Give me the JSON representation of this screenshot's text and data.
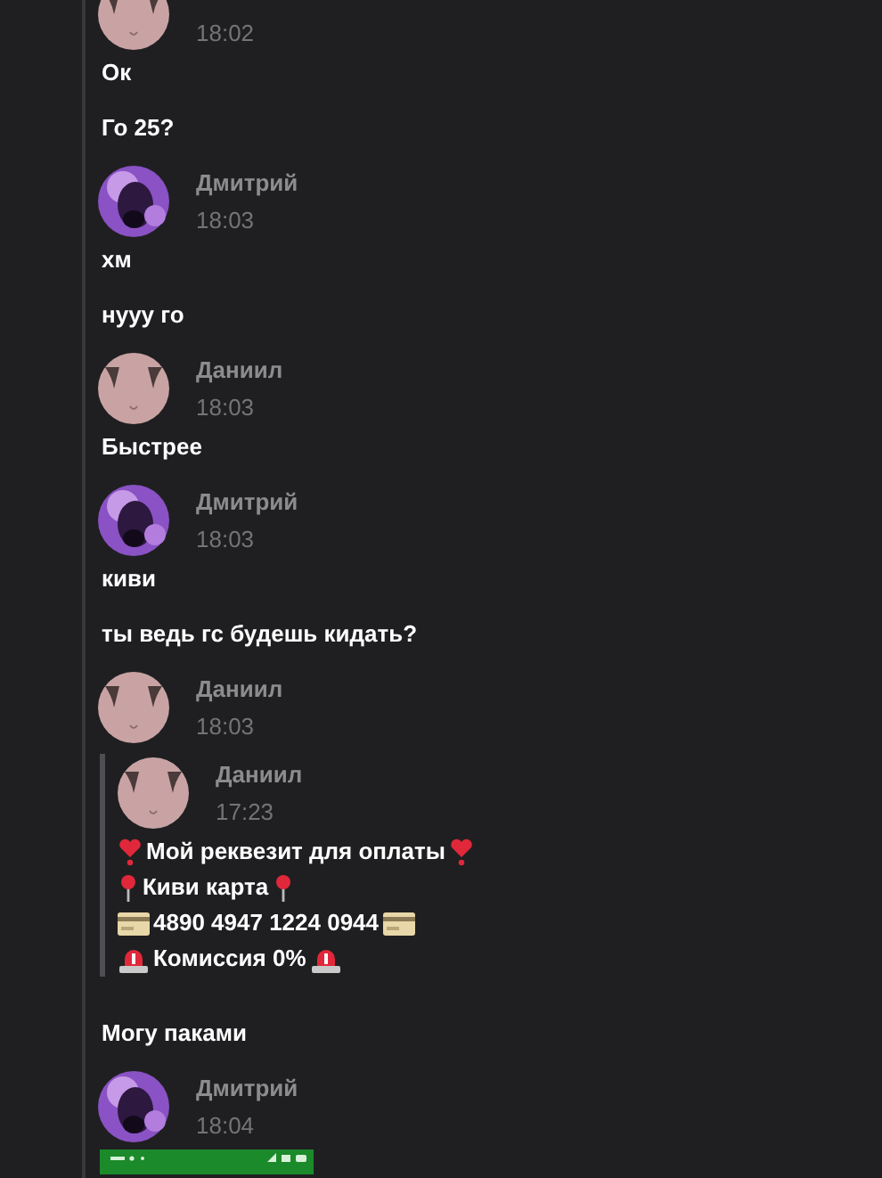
{
  "messages": [
    {
      "kind": "header",
      "avatar": {
        "kind": "pink"
      },
      "time": "18:02"
    },
    {
      "kind": "text",
      "text": "Ок"
    },
    {
      "kind": "text",
      "text": "Го 25?"
    },
    {
      "kind": "header",
      "avatar": {
        "kind": "purple"
      },
      "name": "Дмитрий",
      "time": "18:03"
    },
    {
      "kind": "text",
      "text": "хм"
    },
    {
      "kind": "text",
      "text": "нууу го"
    },
    {
      "kind": "header",
      "avatar": {
        "kind": "pink"
      },
      "name": "Даниил",
      "time": "18:03"
    },
    {
      "kind": "text",
      "text": "Быстрее"
    },
    {
      "kind": "header",
      "avatar": {
        "kind": "purple"
      },
      "name": "Дмитрий",
      "time": "18:03"
    },
    {
      "kind": "text",
      "text": "киви"
    },
    {
      "kind": "text",
      "text": "ты ведь гс будешь кидать?"
    },
    {
      "kind": "header",
      "avatar": {
        "kind": "pink"
      },
      "name": "Даниил",
      "time": "18:03"
    },
    {
      "kind": "quote",
      "avatar": {
        "kind": "pink"
      },
      "name": "Даниил",
      "time": "17:23",
      "lines": [
        {
          "kind": "heart",
          "text": "Мой реквезит для оплаты"
        },
        {
          "kind": "pin",
          "text": "Киви карта"
        },
        {
          "kind": "card",
          "text": "4890 4947 1224 0944"
        },
        {
          "kind": "siren",
          "text": "Комиссия 0%"
        }
      ]
    },
    {
      "kind": "text",
      "text": "Могу паками"
    },
    {
      "kind": "header",
      "avatar": {
        "kind": "purple"
      },
      "name": "Дмитрий",
      "time": "18:04"
    },
    {
      "kind": "picture"
    }
  ]
}
